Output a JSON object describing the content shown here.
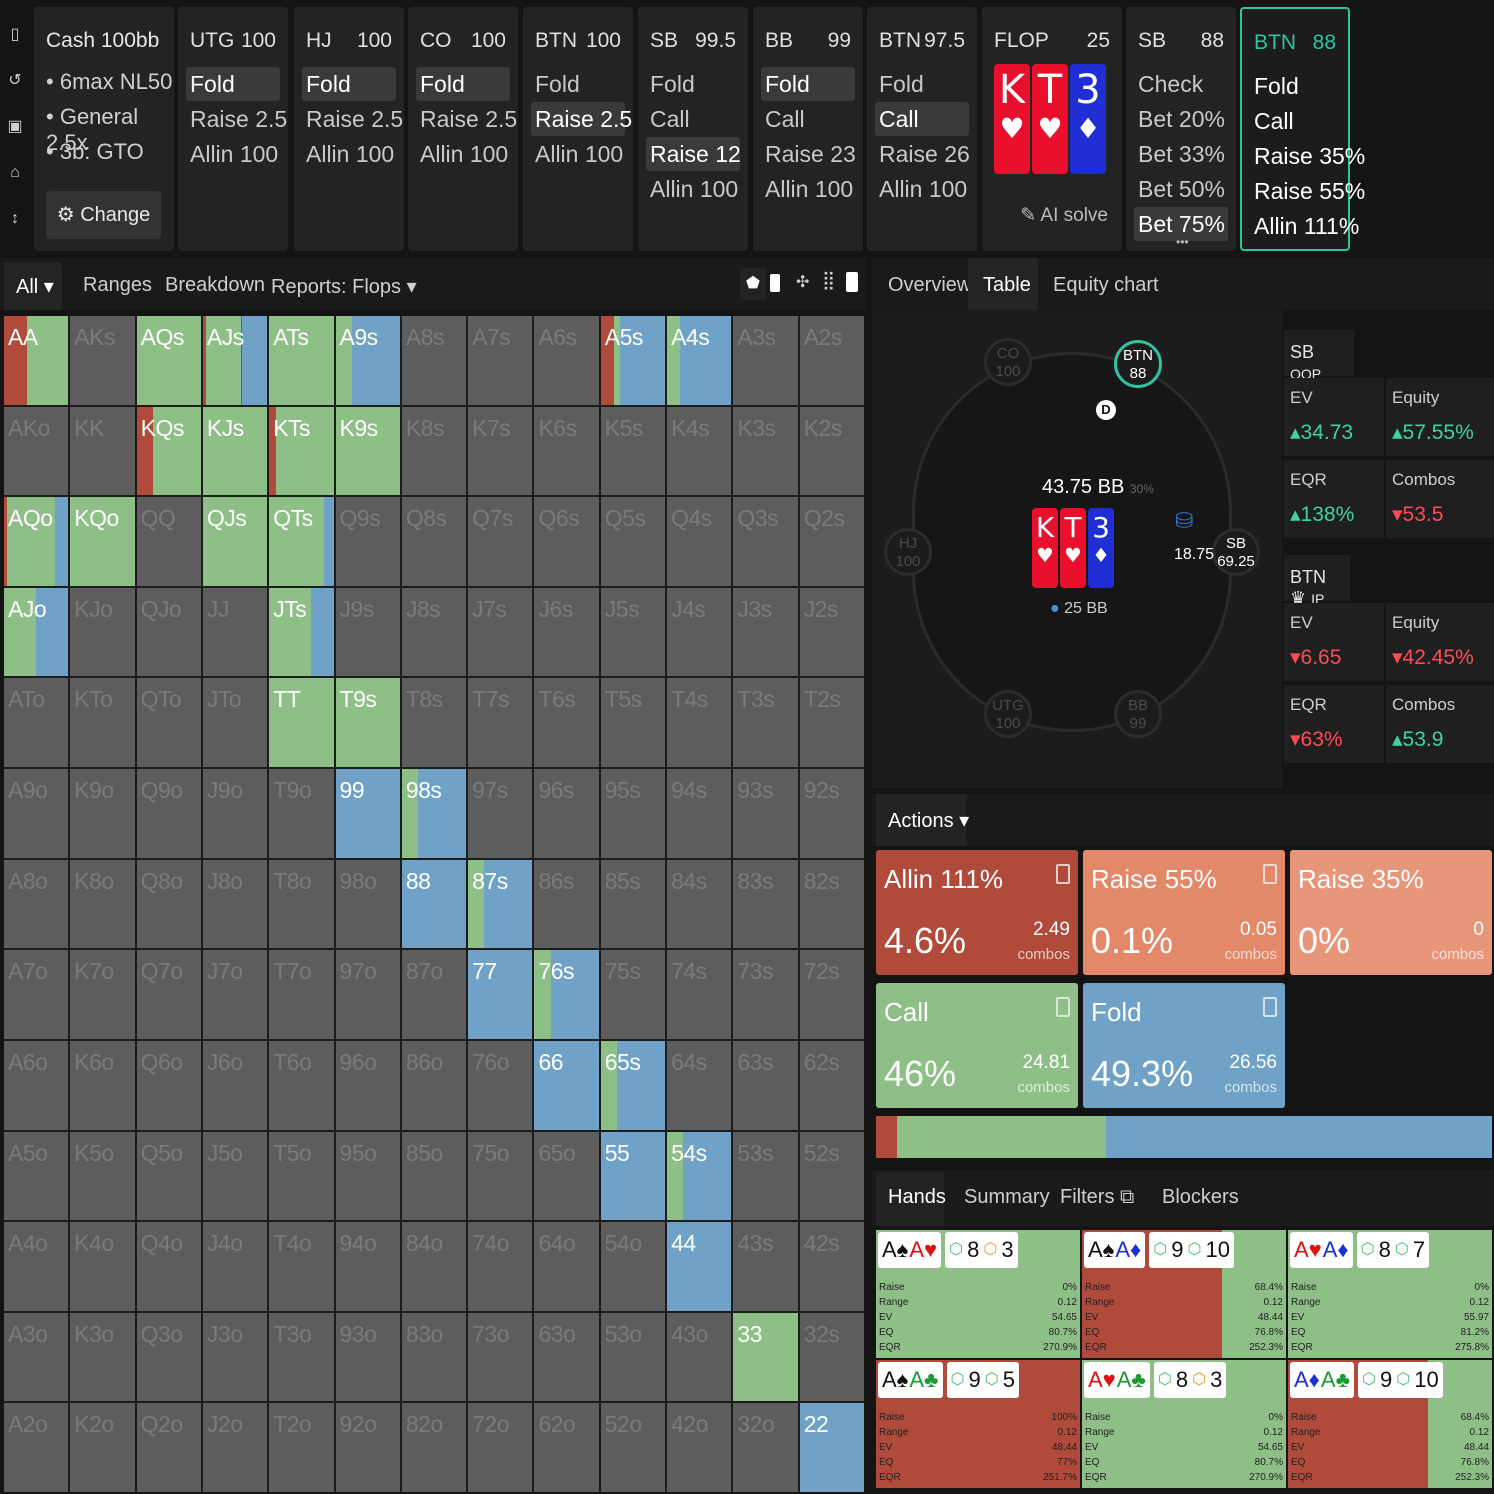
{
  "rail": {
    "icons": [
      "bookmark-icon",
      "history-icon",
      "save-icon",
      "gamepad-icon",
      "text-height-icon"
    ]
  },
  "cash": {
    "title": "Cash 100bb",
    "items": [
      "6max NL50",
      "General 2.5x",
      "3b: GTO"
    ],
    "change": "Change"
  },
  "columns": [
    {
      "pos": "UTG",
      "stack": "100",
      "actions": [
        "Fold",
        "Raise 2.5",
        "Allin 100"
      ],
      "sel": 0
    },
    {
      "pos": "HJ",
      "stack": "100",
      "actions": [
        "Fold",
        "Raise 2.5",
        "Allin 100"
      ],
      "sel": 0
    },
    {
      "pos": "CO",
      "stack": "100",
      "actions": [
        "Fold",
        "Raise 2.5",
        "Allin 100"
      ],
      "sel": 0
    },
    {
      "pos": "BTN",
      "stack": "100",
      "actions": [
        "Fold",
        "Raise 2.5",
        "Allin 100"
      ],
      "sel": 1
    },
    {
      "pos": "SB",
      "stack": "99.5",
      "actions": [
        "Fold",
        "Call",
        "Raise 12",
        "Allin 100"
      ],
      "sel": 2
    },
    {
      "pos": "BB",
      "stack": "99",
      "actions": [
        "Fold",
        "Call",
        "Raise 23",
        "Allin 100"
      ],
      "sel": 0
    },
    {
      "pos": "BTN",
      "stack": "97.5",
      "actions": [
        "Fold",
        "Call",
        "Raise 26",
        "Allin 100"
      ],
      "sel": 1
    }
  ],
  "flop": {
    "label": "FLOP",
    "pot": "25",
    "cards": [
      {
        "r": "K",
        "s": "♥",
        "c": "red"
      },
      {
        "r": "T",
        "s": "♥",
        "c": "red"
      },
      {
        "r": "3",
        "s": "♦",
        "c": "blue"
      }
    ],
    "ai": "AI solve"
  },
  "sbcol": {
    "pos": "SB",
    "stack": "88",
    "actions": [
      "Check",
      "Bet 20%",
      "Bet 33%",
      "Bet 50%",
      "Bet 75%"
    ],
    "sel": 4
  },
  "btncol": {
    "pos": "BTN",
    "stack": "88",
    "actions": [
      "Fold",
      "Call",
      "Raise 35%",
      "Raise 55%",
      "Allin 111%"
    ]
  },
  "tabs_left": {
    "all": "All",
    "ranges": "Ranges",
    "breakdown": "Breakdown",
    "reports": "Reports: Flops"
  },
  "tabs_right": {
    "overview": "Overview",
    "table": "Table",
    "equity": "Equity chart"
  },
  "grid": [
    [
      "AA",
      "AKs",
      "AQs",
      "AJs",
      "ATs",
      "A9s",
      "A8s",
      "A7s",
      "A6s",
      "A5s",
      "A4s",
      "A3s",
      "A2s"
    ],
    [
      "AKo",
      "KK",
      "KQs",
      "KJs",
      "KTs",
      "K9s",
      "K8s",
      "K7s",
      "K6s",
      "K5s",
      "K4s",
      "K3s",
      "K2s"
    ],
    [
      "AQo",
      "KQo",
      "QQ",
      "QJs",
      "QTs",
      "Q9s",
      "Q8s",
      "Q7s",
      "Q6s",
      "Q5s",
      "Q4s",
      "Q3s",
      "Q2s"
    ],
    [
      "AJo",
      "KJo",
      "QJo",
      "JJ",
      "JTs",
      "J9s",
      "J8s",
      "J7s",
      "J6s",
      "J5s",
      "J4s",
      "J3s",
      "J2s"
    ],
    [
      "ATo",
      "KTo",
      "QTo",
      "JTo",
      "TT",
      "T9s",
      "T8s",
      "T7s",
      "T6s",
      "T5s",
      "T4s",
      "T3s",
      "T2s"
    ],
    [
      "A9o",
      "K9o",
      "Q9o",
      "J9o",
      "T9o",
      "99",
      "98s",
      "97s",
      "96s",
      "95s",
      "94s",
      "93s",
      "92s"
    ],
    [
      "A8o",
      "K8o",
      "Q8o",
      "J8o",
      "T8o",
      "98o",
      "88",
      "87s",
      "86s",
      "85s",
      "84s",
      "83s",
      "82s"
    ],
    [
      "A7o",
      "K7o",
      "Q7o",
      "J7o",
      "T7o",
      "97o",
      "87o",
      "77",
      "76s",
      "75s",
      "74s",
      "73s",
      "72s"
    ],
    [
      "A6o",
      "K6o",
      "Q6o",
      "J6o",
      "T6o",
      "96o",
      "86o",
      "76o",
      "66",
      "65s",
      "64s",
      "63s",
      "62s"
    ],
    [
      "A5o",
      "K5o",
      "Q5o",
      "J5o",
      "T5o",
      "95o",
      "85o",
      "75o",
      "65o",
      "55",
      "54s",
      "53s",
      "52s"
    ],
    [
      "A4o",
      "K4o",
      "Q4o",
      "J4o",
      "T4o",
      "94o",
      "84o",
      "74o",
      "64o",
      "54o",
      "44",
      "43s",
      "42s"
    ],
    [
      "A3o",
      "K3o",
      "Q3o",
      "J3o",
      "T3o",
      "93o",
      "83o",
      "73o",
      "63o",
      "53o",
      "43o",
      "33",
      "32s"
    ],
    [
      "A2o",
      "K2o",
      "Q2o",
      "J2o",
      "T2o",
      "92o",
      "82o",
      "72o",
      "62o",
      "52o",
      "42o",
      "32o",
      "22"
    ]
  ],
  "strategy": {
    "AA": [
      0.35,
      0.65,
      0
    ],
    "AQs": [
      0,
      1,
      0
    ],
    "AJs": [
      0.05,
      0.55,
      0.4
    ],
    "ATs": [
      0,
      1,
      0
    ],
    "A9s": [
      0,
      0.25,
      0.75
    ],
    "A5s": [
      0.2,
      0.1,
      0.7
    ],
    "A4s": [
      0,
      0.2,
      0.8
    ],
    "KQs": [
      0.25,
      0.75,
      0
    ],
    "KJs": [
      0,
      1,
      0
    ],
    "KTs": [
      0.1,
      0.9,
      0
    ],
    "K9s": [
      0,
      1,
      0
    ],
    "AQo": [
      0.05,
      0.75,
      0.2
    ],
    "KQo": [
      0,
      1,
      0
    ],
    "QJs": [
      0,
      1,
      0
    ],
    "QTs": [
      0,
      0.85,
      0.15
    ],
    "AJo": [
      0,
      0.5,
      0.5
    ],
    "JTs": [
      0,
      0.65,
      0.35
    ],
    "TT": [
      0,
      1,
      0
    ],
    "T9s": [
      0,
      1,
      0
    ],
    "99": [
      0,
      0,
      1
    ],
    "98s": [
      0,
      0.25,
      0.75
    ],
    "88": [
      0,
      0,
      1
    ],
    "87s": [
      0,
      0.25,
      0.75
    ],
    "77": [
      0,
      0,
      1
    ],
    "76s": [
      0,
      0.25,
      0.75
    ],
    "66": [
      0,
      0,
      1
    ],
    "65s": [
      0,
      0.25,
      0.75
    ],
    "55": [
      0,
      0,
      1
    ],
    "54s": [
      0,
      0.25,
      0.75
    ],
    "44": [
      0,
      0,
      1
    ],
    "33": [
      0,
      1,
      0
    ],
    "22": [
      0,
      0,
      1
    ]
  },
  "colors": {
    "raise": "#b04a3a",
    "call": "#8ebf86",
    "fold": "#6fa2c6",
    "raise55": "#e38868",
    "raise35": "#e8967a",
    "empty": "#5d5d5d"
  },
  "table": {
    "pot": "43.75 BB",
    "pot_pct": "30%",
    "bet": "25 BB",
    "chip": "18.75",
    "seats": [
      {
        "pos": "CO",
        "stack": "100"
      },
      {
        "pos": "BTN",
        "stack": "88"
      },
      {
        "pos": "HJ",
        "stack": "100"
      },
      {
        "pos": "SB",
        "stack": "69.25"
      },
      {
        "pos": "UTG",
        "stack": "100"
      },
      {
        "pos": "BB",
        "stack": "99"
      }
    ],
    "dealer": "D"
  },
  "sb_stats": {
    "title": "SB",
    "sub": "OOP",
    "ev_l": "EV",
    "ev": "34.73",
    "eq_l": "Equity",
    "eq": "57.55%",
    "eqr_l": "EQR",
    "eqr": "138%",
    "combos_l": "Combos",
    "combos": "53.5"
  },
  "btn_stats": {
    "title": "BTN",
    "sub": "IP",
    "ev_l": "EV",
    "ev": "6.65",
    "eq_l": "Equity",
    "eq": "42.45%",
    "eqr_l": "EQR",
    "eqr": "63%",
    "combos_l": "Combos",
    "combos": "53.9"
  },
  "actions_dd": "Actions",
  "action_boxes": [
    {
      "name": "Allin 111%",
      "pct": "4.6%",
      "combos": "2.49",
      "unit": "combos"
    },
    {
      "name": "Raise 55%",
      "pct": "0.1%",
      "combos": "0.05",
      "unit": "combos"
    },
    {
      "name": "Raise 35%",
      "pct": "0%",
      "combos": "0",
      "unit": "combos"
    },
    {
      "name": "Call",
      "pct": "46%",
      "combos": "24.81",
      "unit": "combos"
    },
    {
      "name": "Fold",
      "pct": "49.3%",
      "combos": "26.56",
      "unit": "combos"
    }
  ],
  "action_bar": {
    "raise": 0.034,
    "call": 0.34,
    "fold": 0.626
  },
  "bottom_tabs": {
    "hands": "Hands",
    "summary": "Summary",
    "filters": "Filters",
    "blockers": "Blockers"
  },
  "hands": [
    {
      "c": [
        [
          "A",
          "♠",
          "bk"
        ],
        [
          "A",
          "♥",
          "rd"
        ]
      ],
      "b": [
        [
          "8",
          "gr"
        ],
        [
          "3",
          "or"
        ]
      ],
      "vals": [
        "0%",
        "0.12",
        "54.65",
        "80.7%",
        "270.9%"
      ],
      "mode": "call",
      "fill": 0
    },
    {
      "c": [
        [
          "A",
          "♠",
          "bk"
        ],
        [
          "A",
          "♦",
          "bl"
        ]
      ],
      "b": [
        [
          "9",
          "gr"
        ],
        [
          "10",
          "gr"
        ]
      ],
      "vals": [
        "68.4%",
        "0.12",
        "48.44",
        "76.8%",
        "252.3%"
      ],
      "mode": "raise",
      "fill": 0.684
    },
    {
      "c": [
        [
          "A",
          "♥",
          "rd"
        ],
        [
          "A",
          "♦",
          "bl"
        ]
      ],
      "b": [
        [
          "8",
          "gr"
        ],
        [
          "7",
          "gr"
        ]
      ],
      "vals": [
        "0%",
        "0.12",
        "55.97",
        "81.2%",
        "275.8%"
      ],
      "mode": "call",
      "fill": 0
    },
    {
      "c": [
        [
          "A",
          "♠",
          "bk"
        ],
        [
          "A",
          "♣",
          "gr"
        ]
      ],
      "b": [
        [
          "9",
          "gr"
        ],
        [
          "5",
          "gr"
        ]
      ],
      "vals": [
        "100%",
        "0.12",
        "48.44",
        "77%",
        "251.7%"
      ],
      "mode": "raise",
      "fill": 1
    },
    {
      "c": [
        [
          "A",
          "♥",
          "rd"
        ],
        [
          "A",
          "♣",
          "gr"
        ]
      ],
      "b": [
        [
          "8",
          "gr"
        ],
        [
          "3",
          "or"
        ]
      ],
      "vals": [
        "0%",
        "0.12",
        "54.65",
        "80.7%",
        "270.9%"
      ],
      "mode": "call",
      "fill": 0
    },
    {
      "c": [
        [
          "A",
          "♦",
          "bl"
        ],
        [
          "A",
          "♣",
          "gr"
        ]
      ],
      "b": [
        [
          "9",
          "gr"
        ],
        [
          "10",
          "gr"
        ]
      ],
      "vals": [
        "68.4%",
        "0.12",
        "48.44",
        "76.8%",
        "252.3%"
      ],
      "mode": "raise",
      "fill": 0.684
    }
  ],
  "hand_labels": [
    "Raise",
    "Range",
    "EV",
    "EQ",
    "EQR"
  ]
}
